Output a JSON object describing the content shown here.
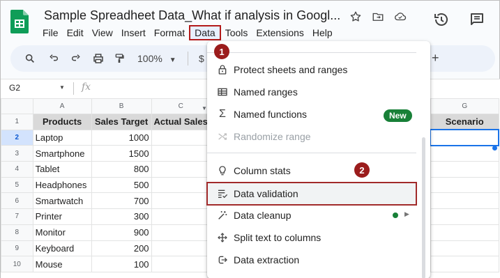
{
  "app": {
    "doc_title": "Sample Spreadheet Data_What if analysis in Googl...",
    "menu": [
      "File",
      "Edit",
      "View",
      "Insert",
      "Format",
      "Data",
      "Tools",
      "Extensions",
      "Help"
    ],
    "active_menu": "Data"
  },
  "toolbar": {
    "zoom": "100%",
    "currency_symbol": "$"
  },
  "formula_bar": {
    "name_box": "G2",
    "fx": "fx"
  },
  "sheet": {
    "columns": [
      "A",
      "B",
      "C",
      "G"
    ],
    "rows": [
      "1",
      "2",
      "3",
      "4",
      "5",
      "6",
      "7",
      "8",
      "9",
      "10"
    ],
    "headers": [
      "Products",
      "Sales Target",
      "Actual Sales",
      "Scenario"
    ],
    "data": [
      [
        "Laptop",
        "1000"
      ],
      [
        "Smartphone",
        "1500"
      ],
      [
        "Tablet",
        "800"
      ],
      [
        "Headphones",
        "500"
      ],
      [
        "Smartwatch",
        "700"
      ],
      [
        "Printer",
        "300"
      ],
      [
        "Monitor",
        "900"
      ],
      [
        "Keyboard",
        "200"
      ],
      [
        "Mouse",
        "100"
      ]
    ],
    "selected_cell": "G2"
  },
  "data_menu": {
    "items": [
      {
        "label": "Protect sheets and ranges",
        "icon": "lock-icon"
      },
      {
        "label": "Named ranges",
        "icon": "table-icon"
      },
      {
        "label": "Named functions",
        "icon": "sigma-icon",
        "badge": "New"
      },
      {
        "label": "Randomize range",
        "icon": "shuffle-icon",
        "disabled": true
      },
      {
        "label": "Column stats",
        "icon": "lightbulb-icon"
      },
      {
        "label": "Data validation",
        "icon": "data-validation-icon",
        "highlighted": true
      },
      {
        "label": "Data cleanup",
        "icon": "magic-wand-icon",
        "has_submenu": true
      },
      {
        "label": "Split text to columns",
        "icon": "split-icon"
      },
      {
        "label": "Data extraction",
        "icon": "extract-icon"
      }
    ]
  },
  "annotations": {
    "step1": "1",
    "step2": "2"
  },
  "colors": {
    "brand_green": "#188038",
    "annotation_red": "#9b1c1c",
    "selection_blue": "#1a73e8"
  }
}
